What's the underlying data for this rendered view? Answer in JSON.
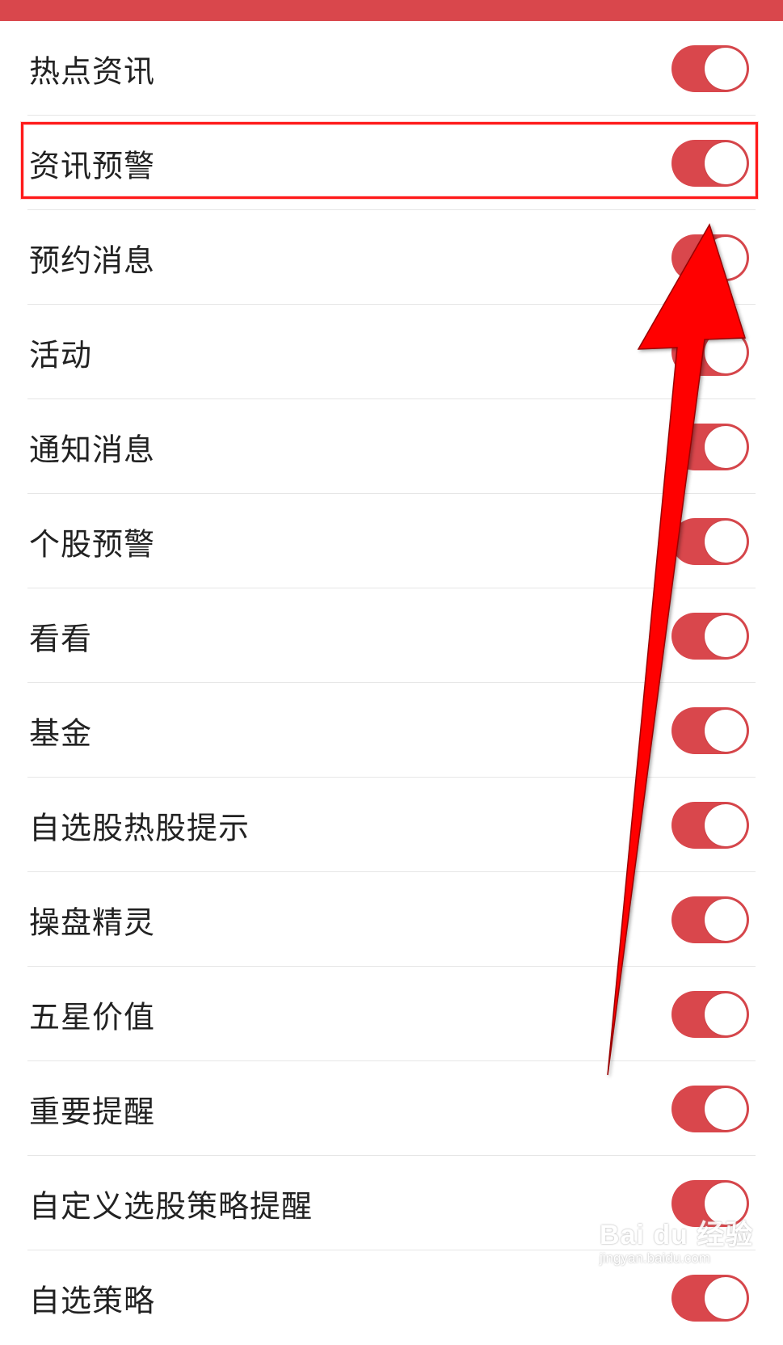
{
  "accent_color": "#d9474c",
  "annotation_color": "#ff1a1a",
  "settings": [
    {
      "label": "热点资讯",
      "enabled": true
    },
    {
      "label": "资讯预警",
      "enabled": true
    },
    {
      "label": "预约消息",
      "enabled": true
    },
    {
      "label": "活动",
      "enabled": true
    },
    {
      "label": "通知消息",
      "enabled": true
    },
    {
      "label": "个股预警",
      "enabled": true
    },
    {
      "label": "看看",
      "enabled": true
    },
    {
      "label": "基金",
      "enabled": true
    },
    {
      "label": "自选股热股提示",
      "enabled": true
    },
    {
      "label": "操盘精灵",
      "enabled": true
    },
    {
      "label": "五星价值",
      "enabled": true
    },
    {
      "label": "重要提醒",
      "enabled": true
    },
    {
      "label": "自定义选股策略提醒",
      "enabled": true
    },
    {
      "label": "自选策略",
      "enabled": true
    }
  ],
  "watermark": {
    "brand": "Bai du 经验",
    "site": "jingyan.baidu.com"
  }
}
